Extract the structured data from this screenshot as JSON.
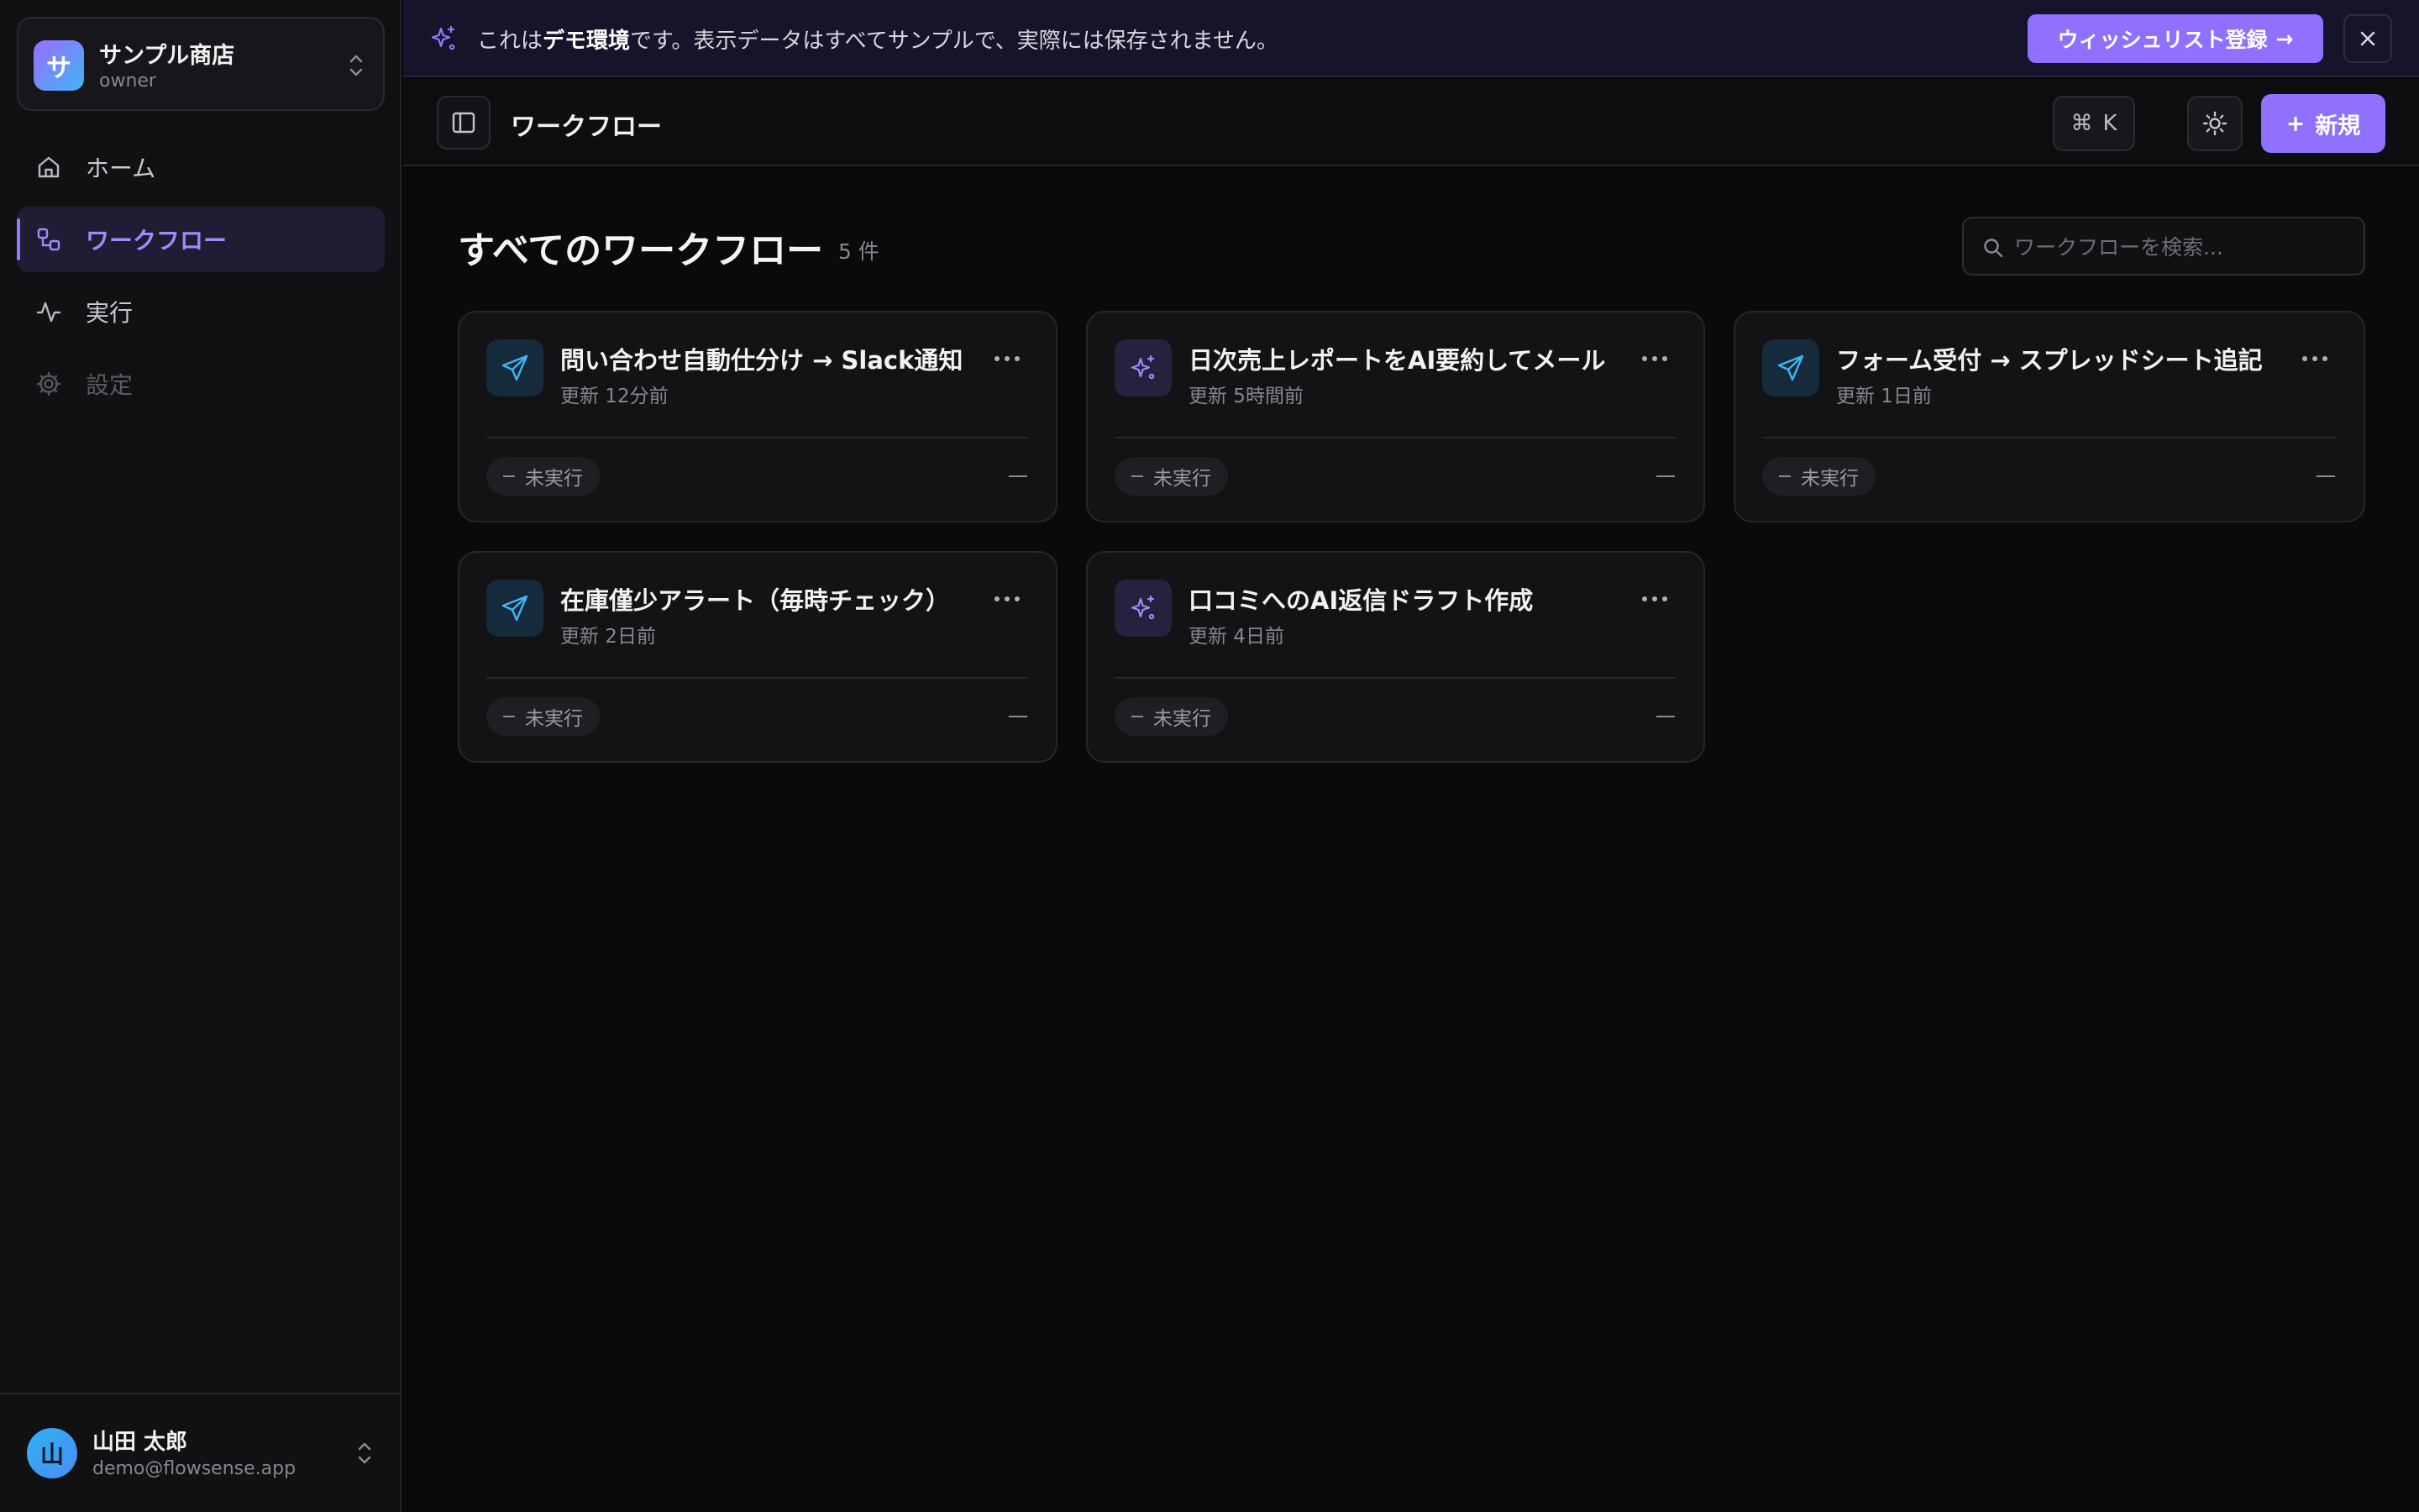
{
  "sidebar": {
    "store": {
      "avatar_letter": "サ",
      "name": "サンプル商店",
      "role": "owner"
    },
    "nav": [
      {
        "label": "ホーム",
        "icon": "home-icon",
        "state": "normal"
      },
      {
        "label": "ワークフロー",
        "icon": "workflow-icon",
        "state": "active"
      },
      {
        "label": "実行",
        "icon": "activity-icon",
        "state": "normal"
      },
      {
        "label": "設定",
        "icon": "gear-icon",
        "state": "disabled"
      }
    ],
    "user": {
      "avatar_letter": "山",
      "name": "山田 太郎",
      "email": "demo@flowsense.app"
    }
  },
  "banner": {
    "text_before": "これは",
    "text_bold": "デモ環境",
    "text_after": "です。表示データはすべてサンプルで、実際には保存されません。",
    "wishlist_label": "ウィッシュリスト登録",
    "wishlist_arrow": "→",
    "close_icon": "close-icon"
  },
  "topbar": {
    "title": "ワークフロー",
    "shortcut_symbol": "⌘",
    "shortcut_key": "K",
    "new_plus": "+",
    "new_label": "新規"
  },
  "main": {
    "heading": "すべてのワークフロー",
    "count": "5 件",
    "search_placeholder": "ワークフローを検索..."
  },
  "workflows": [
    {
      "title": "問い合わせ自動仕分け → Slack通知",
      "updated": "更新 12分前",
      "status": "未実行",
      "icon": "send-icon"
    },
    {
      "title": "日次売上レポートをAI要約してメール",
      "updated": "更新 5時間前",
      "status": "未実行",
      "icon": "sparkles-icon"
    },
    {
      "title": "フォーム受付 → スプレッドシート追記",
      "updated": "更新 1日前",
      "status": "未実行",
      "icon": "send-icon"
    },
    {
      "title": "在庫僅少アラート（毎時チェック）",
      "updated": "更新 2日前",
      "status": "未実行",
      "icon": "send-icon"
    },
    {
      "title": "口コミへのAI返信ドラフト作成",
      "updated": "更新 4日前",
      "status": "未実行",
      "icon": "sparkles-icon"
    }
  ],
  "colors": {
    "accent": "#8f70ff",
    "accent_text": "#9d8cff",
    "send_icon": "#3fb5f5",
    "background": "#0a0a0c"
  }
}
